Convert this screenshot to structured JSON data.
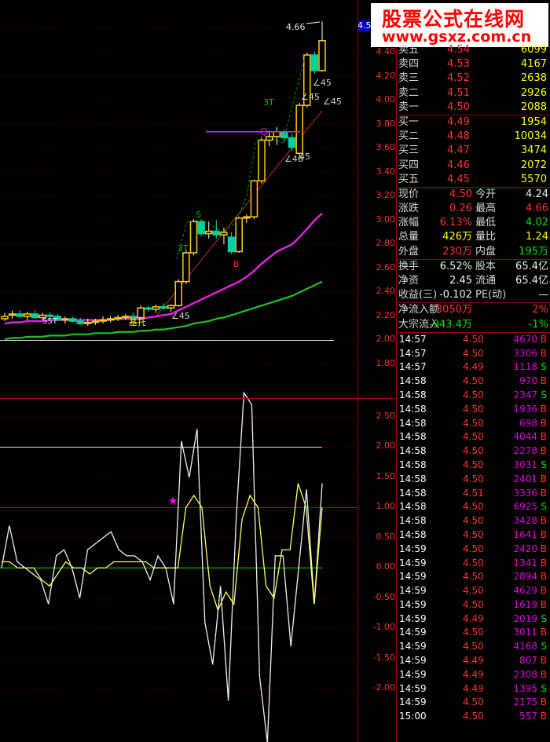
{
  "watermark": {
    "title": "股票公式在线网",
    "url": "www.gsxz.com.cn"
  },
  "current_price_tag": "4.5",
  "chart_data": {
    "type": "candlestick",
    "price_axis": {
      "ticks": [
        "4.40",
        "4.20",
        "4.00",
        "3.80",
        "3.60",
        "3.40",
        "3.20",
        "3.00",
        "2.80",
        "2.60",
        "2.40",
        "2.20",
        "2.00",
        "1.80"
      ],
      "min": 1.72,
      "max": 4.72
    },
    "candles": [
      {
        "o": 2.18,
        "h": 2.23,
        "l": 2.16,
        "c": 2.2
      },
      {
        "o": 2.21,
        "h": 2.25,
        "l": 2.18,
        "c": 2.22
      },
      {
        "o": 2.22,
        "h": 2.25,
        "l": 2.19,
        "c": 2.2
      },
      {
        "o": 2.2,
        "h": 2.24,
        "l": 2.17,
        "c": 2.22
      },
      {
        "o": 2.22,
        "h": 2.25,
        "l": 2.18,
        "c": 2.19
      },
      {
        "o": 2.19,
        "h": 2.23,
        "l": 2.17,
        "c": 2.21
      },
      {
        "o": 2.21,
        "h": 2.24,
        "l": 2.18,
        "c": 2.2
      },
      {
        "o": 2.2,
        "h": 2.22,
        "l": 2.16,
        "c": 2.17
      },
      {
        "o": 2.17,
        "h": 2.2,
        "l": 2.14,
        "c": 2.18
      },
      {
        "o": 2.18,
        "h": 2.2,
        "l": 2.15,
        "c": 2.16
      },
      {
        "o": 2.16,
        "h": 2.19,
        "l": 2.13,
        "c": 2.14
      },
      {
        "o": 2.14,
        "h": 2.18,
        "l": 2.12,
        "c": 2.15
      },
      {
        "o": 2.15,
        "h": 2.18,
        "l": 2.13,
        "c": 2.16
      },
      {
        "o": 2.16,
        "h": 2.2,
        "l": 2.14,
        "c": 2.17
      },
      {
        "o": 2.17,
        "h": 2.2,
        "l": 2.15,
        "c": 2.18
      },
      {
        "o": 2.18,
        "h": 2.21,
        "l": 2.16,
        "c": 2.19
      },
      {
        "o": 2.19,
        "h": 2.22,
        "l": 2.17,
        "c": 2.2
      },
      {
        "o": 2.2,
        "h": 2.23,
        "l": 2.18,
        "c": 2.19
      },
      {
        "o": 2.19,
        "h": 2.29,
        "l": 2.17,
        "c": 2.27
      },
      {
        "o": 2.27,
        "h": 2.29,
        "l": 2.24,
        "c": 2.26
      },
      {
        "o": 2.26,
        "h": 2.3,
        "l": 2.23,
        "c": 2.28
      },
      {
        "o": 2.28,
        "h": 2.31,
        "l": 2.25,
        "c": 2.27
      },
      {
        "o": 2.27,
        "h": 2.3,
        "l": 2.24,
        "c": 2.29
      },
      {
        "o": 2.29,
        "h": 2.51,
        "l": 2.28,
        "c": 2.49
      },
      {
        "o": 2.49,
        "h": 2.75,
        "l": 2.47,
        "c": 2.73
      },
      {
        "o": 2.73,
        "h": 3.01,
        "l": 2.71,
        "c": 2.99
      },
      {
        "o": 2.99,
        "h": 3.01,
        "l": 2.87,
        "c": 2.89
      },
      {
        "o": 2.89,
        "h": 2.99,
        "l": 2.85,
        "c": 2.91
      },
      {
        "o": 2.91,
        "h": 3.0,
        "l": 2.85,
        "c": 2.88
      },
      {
        "o": 2.88,
        "h": 2.94,
        "l": 2.8,
        "c": 2.9
      },
      {
        "o": 2.86,
        "h": 2.9,
        "l": 2.72,
        "c": 2.74
      },
      {
        "o": 2.74,
        "h": 3.03,
        "l": 2.73,
        "c": 3.02
      },
      {
        "o": 3.02,
        "h": 3.05,
        "l": 2.98,
        "c": 3.03
      },
      {
        "o": 3.03,
        "h": 3.34,
        "l": 3.01,
        "c": 3.33
      },
      {
        "o": 3.33,
        "h": 3.69,
        "l": 3.31,
        "c": 3.67
      },
      {
        "o": 3.67,
        "h": 3.75,
        "l": 3.62,
        "c": 3.7
      },
      {
        "o": 3.7,
        "h": 3.78,
        "l": 3.63,
        "c": 3.74
      },
      {
        "o": 3.74,
        "h": 3.76,
        "l": 3.65,
        "c": 3.69
      },
      {
        "o": 3.69,
        "h": 3.73,
        "l": 3.58,
        "c": 3.61
      },
      {
        "o": 3.56,
        "h": 3.98,
        "l": 3.54,
        "c": 3.96
      },
      {
        "o": 3.96,
        "h": 4.4,
        "l": 3.94,
        "c": 4.38
      },
      {
        "o": 4.38,
        "h": 4.41,
        "l": 4.22,
        "c": 4.25
      },
      {
        "o": 4.25,
        "h": 4.66,
        "l": 4.24,
        "c": 4.5
      }
    ],
    "ma_pink": [
      2.14,
      2.15,
      2.15,
      2.16,
      2.16,
      2.16,
      2.17,
      2.17,
      2.17,
      2.17,
      2.17,
      2.17,
      2.17,
      2.17,
      2.17,
      2.18,
      2.18,
      2.18,
      2.18,
      2.19,
      2.2,
      2.21,
      2.22,
      2.25,
      2.28,
      2.31,
      2.34,
      2.37,
      2.4,
      2.43,
      2.46,
      2.49,
      2.53,
      2.58,
      2.64,
      2.69,
      2.74,
      2.77,
      2.8,
      2.86,
      2.93,
      3.0,
      3.06
    ],
    "ma_green": [
      2.01,
      2.02,
      2.02,
      2.03,
      2.03,
      2.03,
      2.04,
      2.04,
      2.04,
      2.05,
      2.05,
      2.05,
      2.06,
      2.06,
      2.06,
      2.07,
      2.07,
      2.07,
      2.08,
      2.08,
      2.09,
      2.09,
      2.1,
      2.11,
      2.12,
      2.14,
      2.15,
      2.16,
      2.18,
      2.19,
      2.21,
      2.23,
      2.25,
      2.27,
      2.29,
      2.31,
      2.33,
      2.35,
      2.37,
      2.4,
      2.43,
      2.46,
      2.49
    ],
    "indicator_axis": {
      "ticks": [
        "2.50",
        "2.00",
        "1.50",
        "1.00",
        "0.50",
        "0.00",
        "-0.50",
        "-1.00",
        "-1.50",
        "-2.00"
      ],
      "min": -2.9,
      "max": 3.15
    },
    "indicator_white": [
      0.0,
      0.7,
      0.1,
      0.0,
      -0.1,
      -0.2,
      -0.6,
      0.2,
      0.3,
      0.0,
      -0.5,
      0.3,
      0.4,
      0.5,
      0.6,
      0.3,
      0.2,
      0.2,
      0.1,
      -0.2,
      0.2,
      0.0,
      -0.6,
      2.1,
      1.5,
      2.3,
      -0.9,
      -1.6,
      -0.3,
      -2.2,
      0.8,
      2.9,
      2.7,
      -1.8,
      -2.9,
      0.2,
      0.2,
      -1.3,
      0.0,
      1.3,
      -0.6,
      1.4
    ],
    "indicator_yellow": [
      0.1,
      0.1,
      0.0,
      0.0,
      0.0,
      -0.2,
      -0.3,
      -0.1,
      0.1,
      0.0,
      0.0,
      -0.1,
      0.0,
      0.0,
      0.1,
      0.1,
      0.1,
      0.1,
      0.1,
      0.0,
      0.0,
      0.0,
      0.0,
      1.0,
      1.2,
      1.0,
      -0.3,
      -0.7,
      -0.4,
      -0.6,
      0.8,
      1.2,
      1.0,
      -0.3,
      -0.5,
      0.3,
      0.3,
      1.4,
      1.0,
      -0.6,
      1.0
    ],
    "annotations": {
      "peak_label": "4.66",
      "angle_labels": [
        "∠45",
        "∠45",
        "∠45",
        "∠46",
        "45",
        "∠45"
      ],
      "markers": [
        "3T",
        "S",
        "3T",
        "B",
        "55T",
        "基托"
      ],
      "h1": "2.00",
      "h2": "1.00",
      "h3": "0.00"
    }
  },
  "quote": {
    "asks": [
      {
        "label": "卖五",
        "price": "4.54",
        "vol": "6099"
      },
      {
        "label": "卖四",
        "price": "4.53",
        "vol": "4167"
      },
      {
        "label": "卖三",
        "price": "4.52",
        "vol": "2638"
      },
      {
        "label": "卖二",
        "price": "4.51",
        "vol": "2926"
      },
      {
        "label": "卖一",
        "price": "4.50",
        "vol": "2088"
      }
    ],
    "bids": [
      {
        "label": "买一",
        "price": "4.49",
        "vol": "1954"
      },
      {
        "label": "买二",
        "price": "4.48",
        "vol": "10034"
      },
      {
        "label": "买三",
        "price": "4.47",
        "vol": "3474"
      },
      {
        "label": "买四",
        "price": "4.46",
        "vol": "2072"
      },
      {
        "label": "买五",
        "price": "4.45",
        "vol": "5570"
      }
    ],
    "stats": [
      {
        "l1": "现价",
        "v1": "4.50",
        "l2": "今开",
        "v2": "4.24"
      },
      {
        "l1": "涨跌",
        "v1": "0.26",
        "l2": "最高",
        "v2": "4.66"
      },
      {
        "l1": "涨幅",
        "v1": "6.13%",
        "l2": "最低",
        "v2": "4.02"
      },
      {
        "l1": "总量",
        "v1": "426万",
        "l2": "量比",
        "v2": "1.24"
      },
      {
        "l1": "外盘",
        "v1": "230万",
        "l2": "内盘",
        "v2": "195万"
      }
    ],
    "stats2": [
      {
        "l1": "换手",
        "v1": "6.52%",
        "l2": "股本",
        "v2": "65.4亿"
      },
      {
        "l1": "净资",
        "v1": "2.45",
        "l2": "流通",
        "v2": "65.4亿"
      },
      {
        "l1": "收益(三)",
        "v1": "-0.102",
        "l2": "PE(动)",
        "v2": "—"
      }
    ],
    "flows": [
      {
        "label": "净流入额",
        "value": "3050万",
        "pct": "2%"
      },
      {
        "label": "大宗流入",
        "value": "-943.4万",
        "pct": "-1%"
      }
    ]
  },
  "ticks": [
    {
      "t": "14:57",
      "p": "4.50",
      "v": "4670",
      "s": "B"
    },
    {
      "t": "14:57",
      "p": "4.50",
      "v": "3306",
      "s": "B"
    },
    {
      "t": "14:57",
      "p": "4.49",
      "v": "1118",
      "s": "S"
    },
    {
      "t": "14:58",
      "p": "4.50",
      "v": "970",
      "s": "B"
    },
    {
      "t": "14:58",
      "p": "4.50",
      "v": "2347",
      "s": "S"
    },
    {
      "t": "14:58",
      "p": "4.50",
      "v": "1936",
      "s": "B"
    },
    {
      "t": "14:58",
      "p": "4.50",
      "v": "698",
      "s": "B"
    },
    {
      "t": "14:58",
      "p": "4.50",
      "v": "4044",
      "s": "B"
    },
    {
      "t": "14:58",
      "p": "4.50",
      "v": "2278",
      "s": "B"
    },
    {
      "t": "14:58",
      "p": "4.50",
      "v": "3031",
      "s": "S"
    },
    {
      "t": "14:58",
      "p": "4.50",
      "v": "2401",
      "s": "B"
    },
    {
      "t": "14:58",
      "p": "4.51",
      "v": "3336",
      "s": "B"
    },
    {
      "t": "14:58",
      "p": "4.50",
      "v": "6925",
      "s": "S"
    },
    {
      "t": "14:58",
      "p": "4.50",
      "v": "3428",
      "s": "B"
    },
    {
      "t": "14:58",
      "p": "4.50",
      "v": "1641",
      "s": "B"
    },
    {
      "t": "14:59",
      "p": "4.50",
      "v": "2420",
      "s": "B"
    },
    {
      "t": "14:59",
      "p": "4.50",
      "v": "1341",
      "s": "B"
    },
    {
      "t": "14:59",
      "p": "4.50",
      "v": "2894",
      "s": "B"
    },
    {
      "t": "14:59",
      "p": "4.50",
      "v": "4629",
      "s": "B"
    },
    {
      "t": "14:59",
      "p": "4.50",
      "v": "1619",
      "s": "B"
    },
    {
      "t": "14:59",
      "p": "4.49",
      "v": "2019",
      "s": "S"
    },
    {
      "t": "14:59",
      "p": "4.50",
      "v": "3011",
      "s": "B"
    },
    {
      "t": "14:59",
      "p": "4.50",
      "v": "4168",
      "s": "S"
    },
    {
      "t": "14:59",
      "p": "4.49",
      "v": "807",
      "s": "B"
    },
    {
      "t": "14:59",
      "p": "4.49",
      "v": "2308",
      "s": "B"
    },
    {
      "t": "14:59",
      "p": "4.49",
      "v": "1395",
      "s": "S"
    },
    {
      "t": "14:59",
      "p": "4.50",
      "v": "2175",
      "s": "B"
    },
    {
      "t": "15:00",
      "p": "4.50",
      "v": "557",
      "s": "B"
    }
  ]
}
